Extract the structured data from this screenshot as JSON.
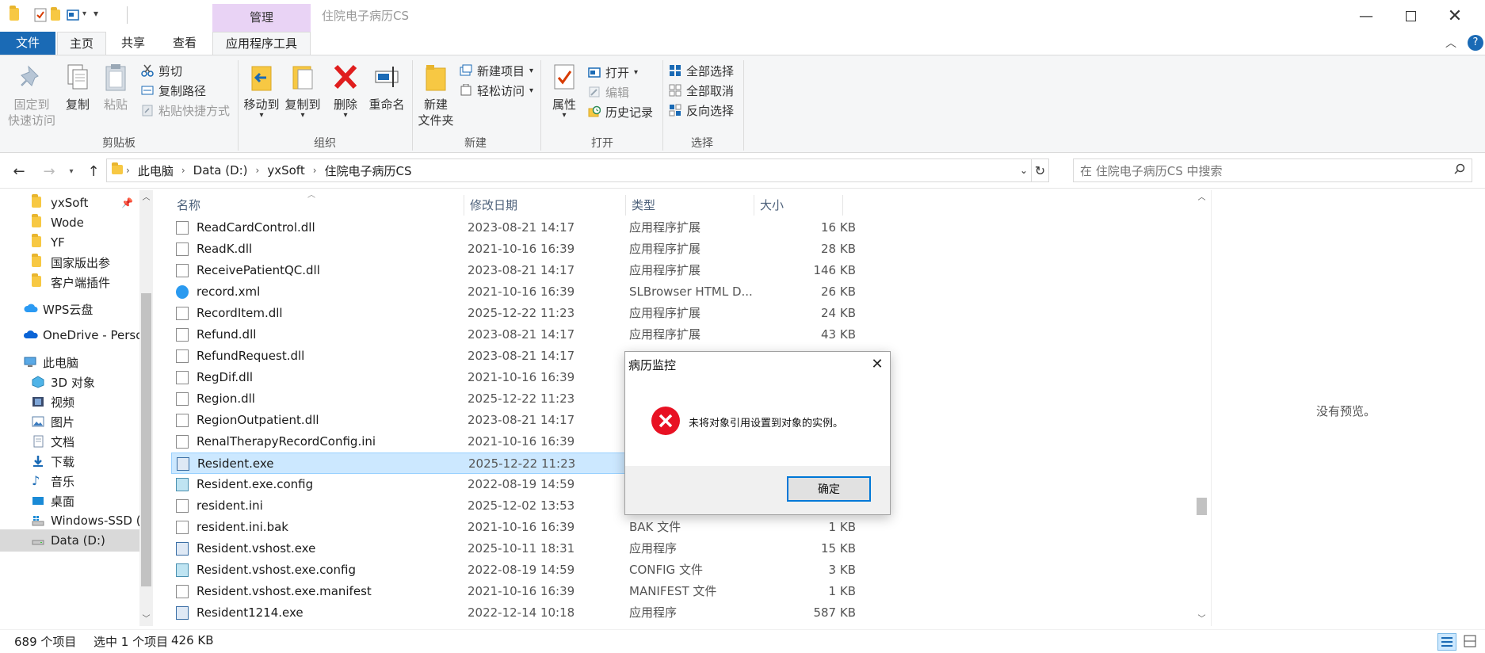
{
  "window": {
    "title": "住院电子病历CS",
    "context_tab_group": "管理"
  },
  "tabs": {
    "file": "文件",
    "home": "主页",
    "share": "共享",
    "view": "查看",
    "app_tools": "应用程序工具"
  },
  "ribbon": {
    "clipboard": {
      "label": "剪贴板",
      "pin": "固定到",
      "pin2": "快速访问",
      "copy": "复制",
      "paste": "粘贴",
      "cut": "剪切",
      "copy_path": "复制路径",
      "paste_shortcut": "粘贴快捷方式"
    },
    "organize": {
      "label": "组织",
      "move_to": "移动到",
      "copy_to": "复制到",
      "delete": "删除",
      "rename": "重命名"
    },
    "new": {
      "label": "新建",
      "new_folder": "新建",
      "new_folder2": "文件夹",
      "new_item": "新建项目",
      "easy_access": "轻松访问"
    },
    "open": {
      "label": "打开",
      "properties": "属性",
      "open": "打开",
      "edit": "编辑",
      "history": "历史记录"
    },
    "select": {
      "label": "选择",
      "select_all": "全部选择",
      "select_none": "全部取消",
      "invert": "反向选择"
    }
  },
  "address": {
    "crumbs": [
      "此电脑",
      "Data (D:)",
      "yxSoft",
      "住院电子病历CS"
    ],
    "search_placeholder": "在 住院电子病历CS 中搜索"
  },
  "nav": {
    "items": [
      "yxSoft",
      "Wode",
      "YF",
      "国家版出参",
      "客户端插件",
      "WPS云盘",
      "OneDrive - Perso",
      "此电脑",
      "3D 对象",
      "视频",
      "图片",
      "文档",
      "下载",
      "音乐",
      "桌面",
      "Windows-SSD (",
      "Data (D:)"
    ]
  },
  "columns": {
    "name": "名称",
    "date": "修改日期",
    "type": "类型",
    "size": "大小"
  },
  "files": [
    {
      "name": "ReadCardControl.dll",
      "date": "2023-08-21 14:17",
      "type": "应用程序扩展",
      "size": "16 KB"
    },
    {
      "name": "ReadK.dll",
      "date": "2021-10-16 16:39",
      "type": "应用程序扩展",
      "size": "28 KB"
    },
    {
      "name": "ReceivePatientQC.dll",
      "date": "2023-08-21 14:17",
      "type": "应用程序扩展",
      "size": "146 KB"
    },
    {
      "name": "record.xml",
      "date": "2021-10-16 16:39",
      "type": "SLBrowser HTML D...",
      "size": "26 KB"
    },
    {
      "name": "RecordItem.dll",
      "date": "2025-12-22 11:23",
      "type": "应用程序扩展",
      "size": "24 KB"
    },
    {
      "name": "Refund.dll",
      "date": "2023-08-21 14:17",
      "type": "应用程序扩展",
      "size": "43 KB"
    },
    {
      "name": "RefundRequest.dll",
      "date": "2023-08-21 14:17",
      "type": "",
      "size": ""
    },
    {
      "name": "RegDif.dll",
      "date": "2021-10-16 16:39",
      "type": "",
      "size": ""
    },
    {
      "name": "Region.dll",
      "date": "2025-12-22 11:23",
      "type": "",
      "size": ""
    },
    {
      "name": "RegionOutpatient.dll",
      "date": "2023-08-21 14:17",
      "type": "",
      "size": ""
    },
    {
      "name": "RenalTherapyRecordConfig.ini",
      "date": "2021-10-16 16:39",
      "type": "",
      "size": ""
    },
    {
      "name": "Resident.exe",
      "date": "2025-12-22 11:23",
      "type": "",
      "size": ""
    },
    {
      "name": "Resident.exe.config",
      "date": "2022-08-19 14:59",
      "type": "",
      "size": ""
    },
    {
      "name": "resident.ini",
      "date": "2025-12-02 13:53",
      "type": "",
      "size": ""
    },
    {
      "name": "resident.ini.bak",
      "date": "2021-10-16 16:39",
      "type": "BAK 文件",
      "size": "1 KB"
    },
    {
      "name": "Resident.vshost.exe",
      "date": "2025-10-11 18:31",
      "type": "应用程序",
      "size": "15 KB"
    },
    {
      "name": "Resident.vshost.exe.config",
      "date": "2022-08-19 14:59",
      "type": "CONFIG 文件",
      "size": "3 KB"
    },
    {
      "name": "Resident.vshost.exe.manifest",
      "date": "2021-10-16 16:39",
      "type": "MANIFEST 文件",
      "size": "1 KB"
    },
    {
      "name": "Resident1214.exe",
      "date": "2022-12-14 10:18",
      "type": "应用程序",
      "size": "587 KB"
    }
  ],
  "preview": {
    "text": "没有预览。"
  },
  "status": {
    "count": "689 个项目",
    "selected": "选中 1 个项目",
    "size": "426 KB"
  },
  "dialog": {
    "title": "病历监控",
    "message": "未将对象引用设置到对象的实例。",
    "ok": "确定"
  },
  "colors": {
    "accent": "#1a6ab5",
    "selection": "#cce8ff",
    "context_tab": "#e9d3f5",
    "error": "#e81123"
  }
}
